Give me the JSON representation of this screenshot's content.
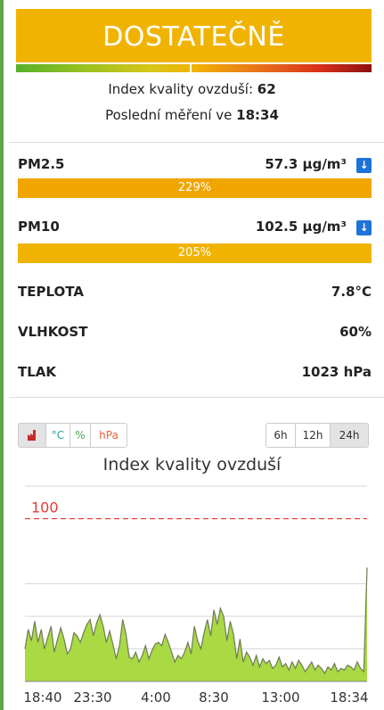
{
  "status": {
    "label": "DOSTATEČNĚ"
  },
  "aqi": {
    "label": "Index kvality ovzduší:",
    "value": "62"
  },
  "last_measurement": {
    "label": "Poslední měření ve",
    "time": "18:34"
  },
  "pollutants": [
    {
      "name": "PM2.5",
      "value": "57.3 μg/m³",
      "percent_label": "229%",
      "percent": 229
    },
    {
      "name": "PM10",
      "value": "102.5 μg/m³",
      "percent_label": "205%",
      "percent": 205
    }
  ],
  "weather": [
    {
      "name": "TEPLOTA",
      "value": "7.8°C"
    },
    {
      "name": "VLHKOST",
      "value": "60%"
    },
    {
      "name": "TLAK",
      "value": "1023 hPa"
    }
  ],
  "info_icon": "info-icon",
  "metric_tabs": [
    {
      "icon": "factory-icon",
      "label": "",
      "active": true
    },
    {
      "label": "°C",
      "active": false
    },
    {
      "label": "%",
      "active": false
    },
    {
      "label": "hPa",
      "active": false
    }
  ],
  "range_tabs": [
    {
      "label": "6h",
      "active": false
    },
    {
      "label": "12h",
      "active": false
    },
    {
      "label": "24h",
      "active": true
    }
  ],
  "colors": {
    "status": "#f1b302",
    "pm25_bar": "#f0a500",
    "pm10_bar": "#f1b302",
    "threshold": "#e53935",
    "area": "#a9d943"
  },
  "chart_data": {
    "type": "area",
    "title": "Index kvality ovzduší",
    "threshold": {
      "value": 100,
      "label": "100"
    },
    "ylim": [
      0,
      120
    ],
    "grid": true,
    "xticks": [
      "18:40",
      "23:30",
      "4:00",
      "8:30",
      "13:00",
      "18:34"
    ],
    "values": [
      20,
      32,
      25,
      37,
      24,
      32,
      20,
      27,
      34,
      18,
      26,
      33,
      26,
      17,
      20,
      30,
      28,
      24,
      30,
      35,
      38,
      28,
      36,
      41,
      34,
      24,
      31,
      23,
      14,
      22,
      38,
      29,
      15,
      14,
      18,
      12,
      16,
      22,
      14,
      19,
      23,
      24,
      22,
      29,
      24,
      18,
      12,
      16,
      14,
      18,
      24,
      17,
      34,
      25,
      20,
      30,
      38,
      28,
      44,
      35,
      45,
      40,
      25,
      37,
      29,
      14,
      26,
      12,
      18,
      15,
      10,
      16,
      9,
      14,
      11,
      13,
      8,
      10,
      15,
      9,
      11,
      7,
      12,
      8,
      13,
      10,
      6,
      9,
      12,
      7,
      10,
      8,
      5,
      9,
      7,
      11,
      6,
      8,
      7,
      10,
      9,
      7,
      12,
      8,
      6,
      70
    ]
  }
}
